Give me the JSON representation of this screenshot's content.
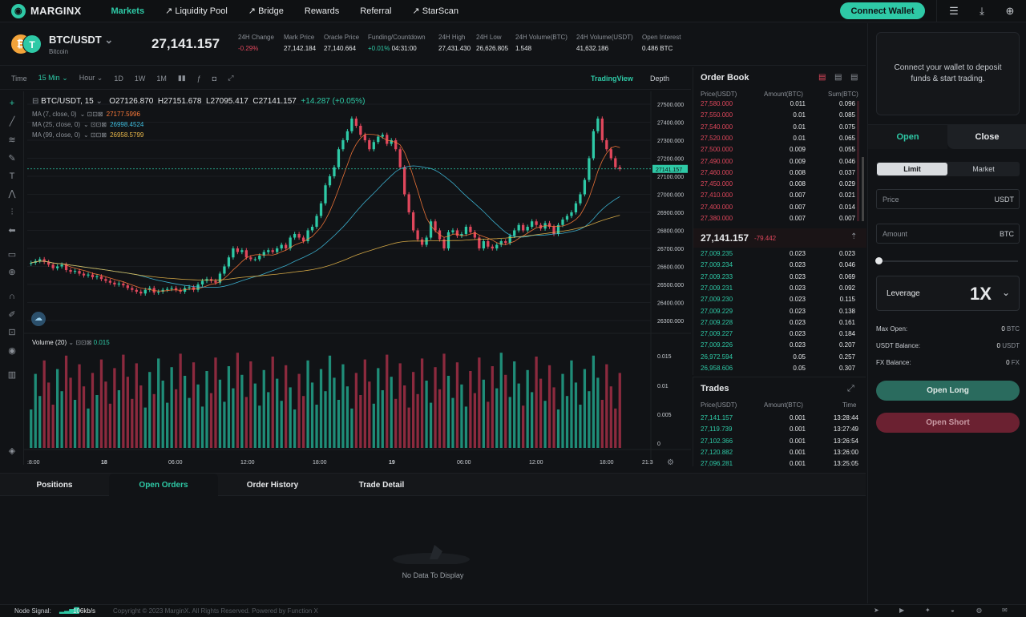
{
  "app": {
    "name": "MARGINX"
  },
  "nav": [
    {
      "label": "Markets",
      "active": true,
      "ext": false
    },
    {
      "label": "Liquidity Pool",
      "active": false,
      "ext": true
    },
    {
      "label": "Bridge",
      "active": false,
      "ext": true
    },
    {
      "label": "Rewards",
      "active": false,
      "ext": false
    },
    {
      "label": "Referral",
      "active": false,
      "ext": false
    },
    {
      "label": "StarScan",
      "active": false,
      "ext": true
    }
  ],
  "connect_label": "Connect Wallet",
  "ticker": {
    "pair": "BTC/USDT",
    "sub": "Bitcoin",
    "price": "27,141.157",
    "stats": [
      {
        "label": "24H Change",
        "value": "-0.29%",
        "tone": "r"
      },
      {
        "label": "Mark Price",
        "value": "27,142.184",
        "tone": ""
      },
      {
        "label": "Oracle Price",
        "value": "27,140.664",
        "tone": ""
      },
      {
        "label": "Funding/Countdown",
        "value": "+0.01%",
        "value2": "04:31:00",
        "tone": "g"
      },
      {
        "label": "24H High",
        "value": "27,431.430",
        "tone": ""
      },
      {
        "label": "24H Low",
        "value": "26,626.805",
        "tone": ""
      },
      {
        "label": "24H Volume(BTC)",
        "value": "1.548",
        "tone": ""
      },
      {
        "label": "24H Volume(USDT)",
        "value": "41,632.186",
        "tone": ""
      },
      {
        "label": "Open Interest",
        "value": "0.486 BTC",
        "tone": ""
      }
    ]
  },
  "chart_toolbar": {
    "time": "Time",
    "interval": "15 Min",
    "hour": "Hour",
    "ranges": [
      "1D",
      "1W",
      "1M"
    ],
    "tradingview": "TradingView",
    "depth": "Depth"
  },
  "chart_legend": {
    "title": "BTC/USDT, 15",
    "o": "O27126.870",
    "h": "H27151.678",
    "l": "L27095.417",
    "c": "C27141.157",
    "chg": "+14.287 (+0.05%)",
    "ma": [
      {
        "label": "MA (7, close, 0)",
        "value": "27177.5996",
        "color": "#ff7b3a"
      },
      {
        "label": "MA (25, close, 0)",
        "value": "26998.4524",
        "color": "#3fbfe0"
      },
      {
        "label": "MA (99, close, 0)",
        "value": "26958.5799",
        "color": "#e8b74a"
      }
    ],
    "volume_label": "Volume (20)",
    "volume_value": "0.015"
  },
  "chart_data": {
    "type": "candlestick",
    "price_axis": [
      "27500.000",
      "27400.000",
      "27300.000",
      "27200.000",
      "27100.000",
      "27000.000",
      "26900.000",
      "26800.000",
      "26700.000",
      "26600.000",
      "26500.000",
      "26400.000",
      "26300.000"
    ],
    "volume_axis": [
      "0.015",
      "0.01",
      "0.005",
      "0"
    ],
    "time_axis": [
      ":8:00",
      "18",
      "06:00",
      "12:00",
      "18:00",
      "19",
      "06:00",
      "12:00",
      "18:00",
      "21:3"
    ],
    "last_price_tag": "27141.157",
    "ylim": [
      26300,
      27500
    ],
    "close": [
      26620,
      26630,
      26640,
      26625,
      26610,
      26590,
      26600,
      26610,
      26580,
      26570,
      26575,
      26560,
      26550,
      26555,
      26540,
      26545,
      26530,
      26520,
      26510,
      26500,
      26505,
      26495,
      26480,
      26470,
      26460,
      26450,
      26470,
      26480,
      26455,
      26460,
      26470,
      26475,
      26480,
      26470,
      26460,
      26480,
      26485,
      26470,
      26500,
      26520,
      26530,
      26520,
      26510,
      26560,
      26600,
      26650,
      26700,
      26680,
      26690,
      26650,
      26640,
      26640,
      26660,
      26680,
      26690,
      26680,
      26700,
      26720,
      26700,
      26760,
      26780,
      26760,
      26740,
      26800,
      26820,
      26880,
      26950,
      27050,
      27100,
      27150,
      27250,
      27300,
      27350,
      27420,
      27380,
      27330,
      27300,
      27250,
      27290,
      27320,
      27330,
      27280,
      27300,
      27250,
      27150,
      27000,
      26900,
      26800,
      26750,
      26720,
      26760,
      26850,
      26800,
      26750,
      26700,
      26790,
      26800,
      26770,
      26780,
      26820,
      26790,
      26760,
      26700,
      26740,
      26710,
      26700,
      26720,
      26740,
      26730,
      26770,
      26800,
      26830,
      26800,
      26820,
      26850,
      26830,
      26810,
      26840,
      26820,
      26780,
      26830,
      26860,
      26880,
      26900,
      26950,
      27000,
      27080,
      27200,
      27350,
      27420,
      27300,
      27250,
      27200,
      27150,
      27141
    ]
  },
  "order_book": {
    "title": "Order Book",
    "headers": [
      "Price(USDT)",
      "Amount(BTC)",
      "Sum(BTC)"
    ],
    "asks": [
      [
        "27,580.000",
        "0.011",
        "0.096"
      ],
      [
        "27,550.000",
        "0.01",
        "0.085"
      ],
      [
        "27,540.000",
        "0.01",
        "0.075"
      ],
      [
        "27,520.000",
        "0.01",
        "0.065"
      ],
      [
        "27,500.000",
        "0.009",
        "0.055"
      ],
      [
        "27,490.000",
        "0.009",
        "0.046"
      ],
      [
        "27,460.000",
        "0.008",
        "0.037"
      ],
      [
        "27,450.000",
        "0.008",
        "0.029"
      ],
      [
        "27,410.000",
        "0.007",
        "0.021"
      ],
      [
        "27,400.000",
        "0.007",
        "0.014"
      ],
      [
        "27,380.000",
        "0.007",
        "0.007"
      ]
    ],
    "mid_price": "27,141.157",
    "mid_change": "-79.442",
    "bids": [
      [
        "27,009.235",
        "0.023",
        "0.023"
      ],
      [
        "27,009.234",
        "0.023",
        "0.046"
      ],
      [
        "27,009.233",
        "0.023",
        "0.069"
      ],
      [
        "27,009.231",
        "0.023",
        "0.092"
      ],
      [
        "27,009.230",
        "0.023",
        "0.115"
      ],
      [
        "27,009.229",
        "0.023",
        "0.138"
      ],
      [
        "27,009.228",
        "0.023",
        "0.161"
      ],
      [
        "27,009.227",
        "0.023",
        "0.184"
      ],
      [
        "27,009.226",
        "0.023",
        "0.207"
      ],
      [
        "26,972.594",
        "0.05",
        "0.257"
      ],
      [
        "26,958.606",
        "0.05",
        "0.307"
      ]
    ]
  },
  "trades": {
    "title": "Trades",
    "headers": [
      "Price(USDT)",
      "Amount(BTC)",
      "Time"
    ],
    "rows": [
      [
        "27,141.157",
        "0.001",
        "13:28:44"
      ],
      [
        "27,119.739",
        "0.001",
        "13:27:49"
      ],
      [
        "27,102.366",
        "0.001",
        "13:26:54"
      ],
      [
        "27,120.882",
        "0.001",
        "13:26:00"
      ],
      [
        "27,096.281",
        "0.001",
        "13:25:05"
      ]
    ]
  },
  "bottom_tabs": [
    {
      "label": "Positions",
      "active": false
    },
    {
      "label": "Open Orders",
      "active": true
    },
    {
      "label": "Order History",
      "active": false
    },
    {
      "label": "Trade Detail",
      "active": false
    }
  ],
  "empty_text": "No Data To Display",
  "footer": {
    "signal_label": "Node Signal:",
    "signal_value": "106kb/s",
    "copyright": "Copyright © 2023 MarginX. All Rights Reserved. Powered by Function X"
  },
  "right_panel": {
    "wallet_msg": "Connect your wallet to deposit funds & start trading.",
    "open": "Open",
    "close": "Close",
    "limit": "Limit",
    "market": "Market",
    "price_ph": "Price",
    "price_unit": "USDT",
    "amount_ph": "Amount",
    "amount_unit": "BTC",
    "leverage_label": "Leverage",
    "leverage_value": "1X",
    "info": [
      {
        "label": "Max Open:",
        "value": "0",
        "unit": "BTC"
      },
      {
        "label": "USDT Balance:",
        "value": "0",
        "unit": "USDT"
      },
      {
        "label": "FX Balance:",
        "value": "0",
        "unit": "FX"
      }
    ],
    "open_long": "Open Long",
    "open_short": "Open Short"
  },
  "colors": {
    "accent": "#2ec9a6",
    "down": "#e0475c",
    "bg": "#111316"
  }
}
